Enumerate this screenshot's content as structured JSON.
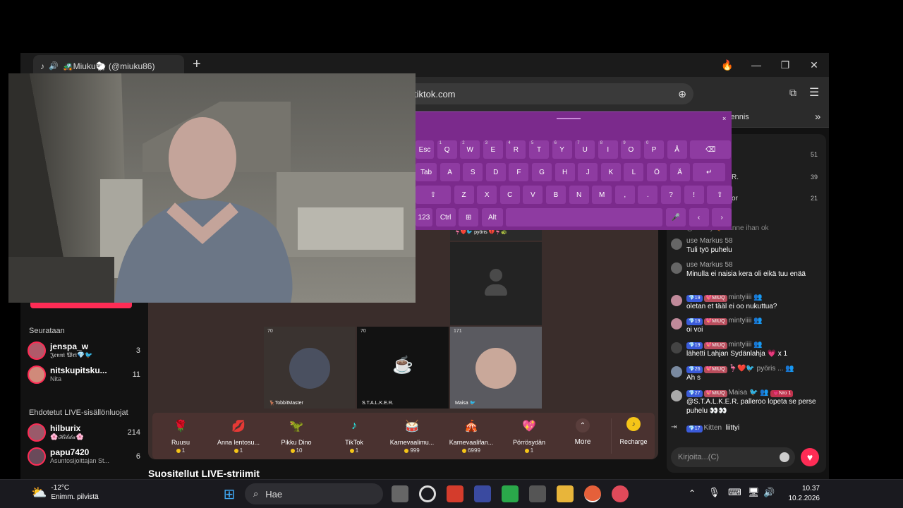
{
  "browser": {
    "tab_title": "🚜Miuku🐑 (@miuku86)",
    "new_tab": "+",
    "url": "tiktok.com",
    "bookmark_right": "Tennis",
    "more_bookmarks": "»"
  },
  "keyboard": {
    "row1": [
      [
        "Esc",
        ""
      ],
      [
        "Q",
        "1"
      ],
      [
        "W",
        "2"
      ],
      [
        "E",
        "3"
      ],
      [
        "R",
        "4"
      ],
      [
        "T",
        "5"
      ],
      [
        "Y",
        "6"
      ],
      [
        "U",
        "7"
      ],
      [
        "I",
        "8"
      ],
      [
        "O",
        "9"
      ],
      [
        "P",
        "0"
      ],
      [
        "Å",
        ""
      ],
      [
        "⌫",
        ""
      ]
    ],
    "row2": [
      [
        "Tab",
        ""
      ],
      [
        "A",
        ""
      ],
      [
        "S",
        ""
      ],
      [
        "D",
        ""
      ],
      [
        "F",
        ""
      ],
      [
        "G",
        ""
      ],
      [
        "H",
        ""
      ],
      [
        "J",
        ""
      ],
      [
        "K",
        ""
      ],
      [
        "L",
        ""
      ],
      [
        "Ö",
        ""
      ],
      [
        "Ä",
        ""
      ],
      [
        "↵",
        ""
      ]
    ],
    "row3": [
      [
        "⇧",
        ""
      ],
      [
        "Z",
        ""
      ],
      [
        "X",
        ""
      ],
      [
        "C",
        ""
      ],
      [
        "V",
        ""
      ],
      [
        "B",
        ""
      ],
      [
        "N",
        ""
      ],
      [
        "M",
        ""
      ],
      [
        ",",
        ""
      ],
      [
        ".",
        ""
      ],
      [
        "?",
        ""
      ],
      [
        "!",
        ""
      ],
      [
        "⇧",
        ""
      ]
    ],
    "row4": [
      [
        "123",
        ""
      ],
      [
        "Ctrl",
        ""
      ],
      [
        "⊞",
        ""
      ],
      [
        "Alt",
        ""
      ],
      [
        "",
        ""
      ],
      [
        "🎤",
        ""
      ],
      [
        "‹",
        ""
      ],
      [
        "›",
        ""
      ]
    ],
    "close": "×"
  },
  "sidebar": {
    "following_title": "Seurataan",
    "following": [
      {
        "name": "jenspa_w",
        "sub": "𝕵𝖊𝖓𝖓𝖎 𝖂𝖗𝖎💎🐦",
        "count": "3"
      },
      {
        "name": "nitskupitsku...",
        "sub": "Nita",
        "count": "11"
      }
    ],
    "suggested_title": "Ehdotetut LIVE-sisällönluojat",
    "suggested": [
      {
        "name": "hilburix",
        "sub": "🌸𝓗𝓲𝓵𝓭𝓪🌸",
        "count": "214"
      },
      {
        "name": "papu7420",
        "sub": "Asuntosijoittajan St...",
        "count": "6"
      }
    ]
  },
  "stage": {
    "top_cell_name": "🦩❤️🐦 pyöris 💔🦩🐢",
    "cells": [
      {
        "count": "70",
        "name": "🦌TobbitMaster"
      },
      {
        "count": "70",
        "name": "S.T.A.L.K.E.R."
      },
      {
        "count": "171",
        "name": "Maisa 🐦"
      }
    ]
  },
  "gifts": [
    {
      "icon": "🌹",
      "name": "Ruusu",
      "price": "1"
    },
    {
      "icon": "💋",
      "name": "Anna lentosu...",
      "price": "1"
    },
    {
      "icon": "🦖",
      "name": "Pikku Dino",
      "price": "10"
    },
    {
      "icon": "♪",
      "name": "TikTok",
      "price": "1"
    },
    {
      "icon": "🥁",
      "name": "Karnevaalimu...",
      "price": "999"
    },
    {
      "icon": "🎪",
      "name": "Karnevaalifan...",
      "price": "6999"
    },
    {
      "icon": "💖",
      "name": "Pörrösydän",
      "price": "1"
    }
  ],
  "gift_more": "More",
  "recharge": "Recharge",
  "suggested_heading": "Suositellut LIVE-striimit",
  "chat": {
    "ranks": [
      {
        "count": "51",
        "name": ""
      },
      {
        "count": "39",
        "name": "R."
      },
      {
        "count": "21",
        "name": "or"
      }
    ],
    "partial": "@Emmy 🐦 tänne ihan ok",
    "messages": [
      {
        "user": "use Markus 58",
        "text": "Tuli työ puhelu",
        "badges": []
      },
      {
        "user": "use Markus 58",
        "text": "Minulla ei naisia kera oli eikä tuu enää",
        "badges": []
      },
      {
        "user": "mintyiiii 👥",
        "text": "oletan et tääl ei oo nukuttua?",
        "badges": [
          [
            "💎19",
            "b-blue"
          ],
          [
            "💖MIUQ",
            "b-pink"
          ]
        ]
      },
      {
        "user": "mintyiiii 👥",
        "text": "oi voi",
        "badges": [
          [
            "💎19",
            "b-blue"
          ],
          [
            "💖MIUQ",
            "b-pink"
          ]
        ]
      },
      {
        "user": "mintyiiii 👥",
        "text": "lähetti Lahjan Sydänlahja 💗 x 1",
        "badges": [
          [
            "💎19",
            "b-blue"
          ],
          [
            "💖MIUQ",
            "b-pink"
          ]
        ]
      },
      {
        "user": "🦩❤️🐦 pyöris ... 👥",
        "text": "Ah s",
        "badges": [
          [
            "💎26",
            "b-blue"
          ],
          [
            "💖MIUQ",
            "b-pink"
          ]
        ]
      },
      {
        "user": "Maisa 🐦 👥",
        "text": "@S.T.A.L.K.E.R. palleroo lopeta se perse puhelu 👀👀",
        "badges": [
          [
            "💎27",
            "b-blue"
          ],
          [
            "💖MIUQ",
            "b-pink"
          ],
          [
            "💗Nro 1",
            "b-red"
          ]
        ]
      }
    ],
    "join_badge": "💎17",
    "join_user": "Kitten",
    "join_text": "liittyi",
    "input_placeholder": "Kirjoita...(C)"
  },
  "taskbar": {
    "weather_temp": "-12°C",
    "weather_desc": "Enimm. pilvistä",
    "search": "Hae",
    "time": "10.37",
    "date": "10.2.2026"
  },
  "colors": {
    "tiktok_red": "#fe2c55",
    "keyboard": "#7b2a8c",
    "stage": "#3a2d2b"
  }
}
